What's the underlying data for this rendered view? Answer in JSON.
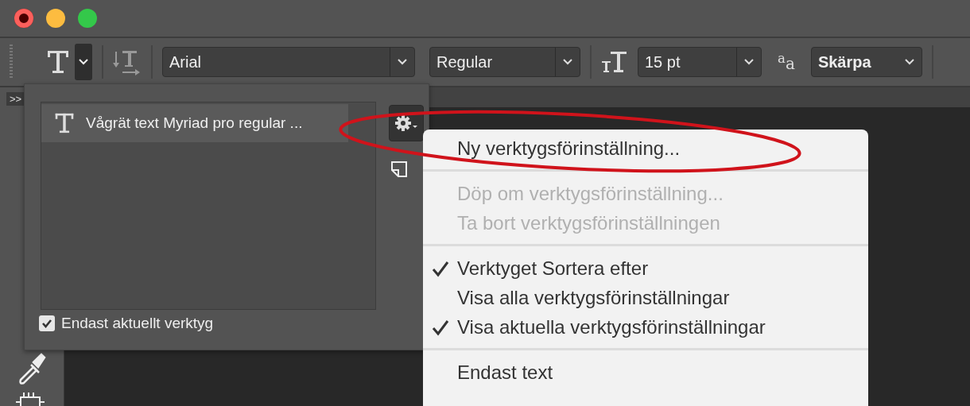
{
  "toolbar": {
    "tool_menu_open": true,
    "font_family": "Arial",
    "font_style": "Regular",
    "font_size": "15 pt",
    "antialias_label": "$^{a}$a",
    "antialias": "Skärpa"
  },
  "tools_panel": {
    "collapse_label": ">>"
  },
  "preset_panel": {
    "presets": [
      {
        "label": "Vågrät text Myriad pro regular ...",
        "selected": true
      }
    ],
    "current_tool_only": {
      "label": "Endast aktuellt verktyg",
      "checked": true
    }
  },
  "menu": {
    "items": [
      {
        "kind": "item",
        "label": "Ny verktygsförinställning...",
        "disabled": false,
        "checked": false
      },
      {
        "kind": "separator"
      },
      {
        "kind": "item",
        "label": "Döp om verktygsförinställning...",
        "disabled": true,
        "checked": false
      },
      {
        "kind": "item",
        "label": "Ta bort verktygsförinställningen",
        "disabled": true,
        "checked": false
      },
      {
        "kind": "separator"
      },
      {
        "kind": "item",
        "label": "Verktyget Sortera efter",
        "disabled": false,
        "checked": true
      },
      {
        "kind": "item",
        "label": "Visa alla verktygsförinställningar",
        "disabled": false,
        "checked": false
      },
      {
        "kind": "item",
        "label": "Visa aktuella verktygsförinställningar",
        "disabled": false,
        "checked": true
      },
      {
        "kind": "separator"
      },
      {
        "kind": "item",
        "label": "Endast text",
        "disabled": false,
        "checked": false
      }
    ]
  }
}
